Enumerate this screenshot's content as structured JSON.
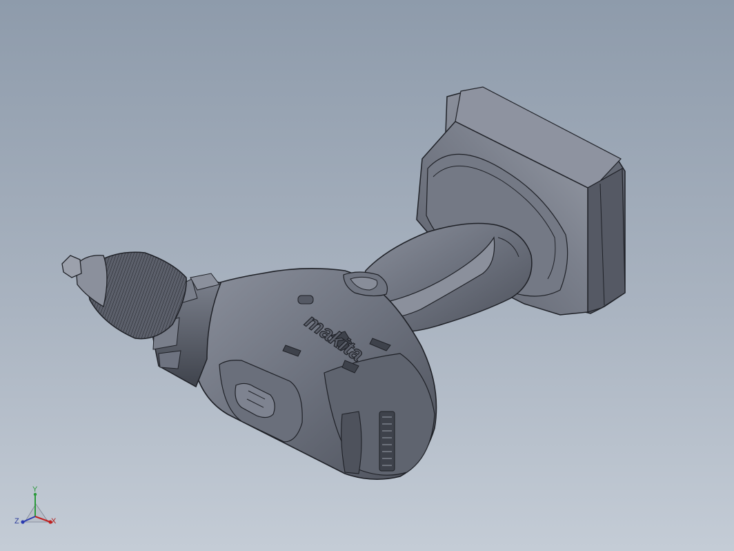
{
  "app": {
    "kind": "3d-cad-graphics-area"
  },
  "model": {
    "name": "cordless-drill",
    "brand_logo_text": "makita",
    "colors": {
      "body": "#6e7380",
      "body_light": "#8a8f9b",
      "body_dark": "#444853",
      "edge": "#1e2026"
    }
  },
  "triad": {
    "y_label": "Y",
    "z_label": "Z",
    "x_label": "X",
    "colors": {
      "x": "#c02020",
      "y": "#2a9a3a",
      "z": "#2a3ab0"
    }
  }
}
